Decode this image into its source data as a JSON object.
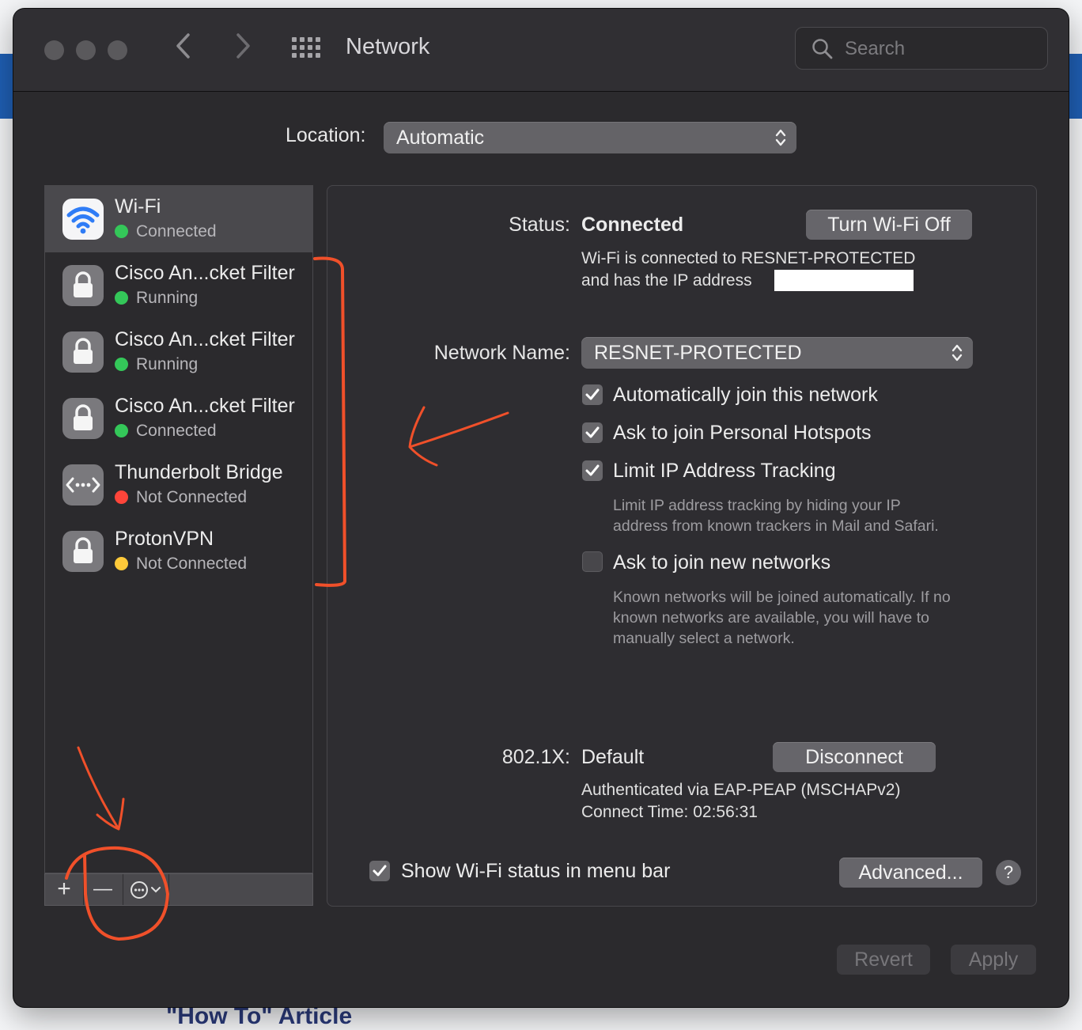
{
  "window": {
    "title": "Network",
    "search_placeholder": "Search"
  },
  "location": {
    "label": "Location:",
    "value": "Automatic"
  },
  "services": [
    {
      "name": "Wi-Fi",
      "status": "Connected",
      "status_color": "#34c759",
      "icon": "wifi-icon",
      "selected": true
    },
    {
      "name": "Cisco An...cket Filter",
      "status": "Running",
      "status_color": "#34c759",
      "icon": "lock-icon"
    },
    {
      "name": "Cisco An...cket Filter",
      "status": "Running",
      "status_color": "#34c759",
      "icon": "lock-icon"
    },
    {
      "name": "Cisco An...cket Filter",
      "status": "Connected",
      "status_color": "#34c759",
      "icon": "lock-icon"
    },
    {
      "name": "Thunderbolt Bridge",
      "status": "Not Connected",
      "status_color": "#ff453a",
      "icon": "bridge-icon"
    },
    {
      "name": "ProtonVPN",
      "status": "Not Connected",
      "status_color": "#ffca3a",
      "icon": "lock-icon"
    }
  ],
  "toolbar": {
    "add": "+",
    "remove": "—"
  },
  "detail": {
    "status_label": "Status:",
    "status_value": "Connected",
    "turn_off_button": "Turn Wi-Fi Off",
    "status_desc_line1": "Wi-Fi is connected to RESNET-PROTECTED",
    "status_desc_line2": "and has the IP address",
    "network_name_label": "Network Name:",
    "network_name_value": "RESNET-PROTECTED",
    "options": [
      {
        "label": "Automatically join this network",
        "checked": true
      },
      {
        "label": "Ask to join Personal Hotspots",
        "checked": true
      },
      {
        "label": "Limit IP Address Tracking",
        "checked": true
      },
      {
        "label": "Ask to join new networks",
        "checked": false
      }
    ],
    "limit_hint_1": "Limit IP address tracking by hiding your IP",
    "limit_hint_2": "address from known trackers in Mail and Safari.",
    "join_hint_1": "Known networks will be joined automatically. If no",
    "join_hint_2": "known networks are available, you will have to",
    "join_hint_3": "manually select a network.",
    "dot1x_label": "802.1X:",
    "dot1x_value": "Default",
    "disconnect_button": "Disconnect",
    "auth_line": "Authenticated via EAP-PEAP (MSCHAPv2)",
    "connect_time": "Connect Time: 02:56:31",
    "show_status_label": "Show Wi-Fi status in menu bar",
    "show_status_checked": true,
    "advanced_button": "Advanced...",
    "help_button": "?"
  },
  "footer": {
    "revert_button": "Revert",
    "apply_button": "Apply"
  },
  "background_text": "\"How To\" Article",
  "colors": {
    "annotation": "#f0502a",
    "window_bg": "#2b2a2d",
    "selected_row": "#4a494d"
  }
}
